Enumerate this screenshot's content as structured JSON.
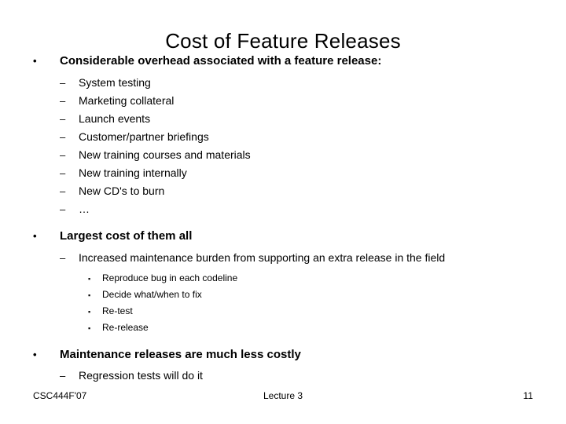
{
  "slide": {
    "title": "Cost of Feature Releases",
    "bullets": [
      {
        "level": 1,
        "marker": "•",
        "text": "Considerable overhead associated with a feature release:"
      },
      {
        "level": 2,
        "marker": "–",
        "text": "System testing"
      },
      {
        "level": 2,
        "marker": "–",
        "text": "Marketing collateral"
      },
      {
        "level": 2,
        "marker": "–",
        "text": "Launch events"
      },
      {
        "level": 2,
        "marker": "–",
        "text": "Customer/partner briefings"
      },
      {
        "level": 2,
        "marker": "–",
        "text": "New training courses and materials"
      },
      {
        "level": 2,
        "marker": "–",
        "text": "New training internally"
      },
      {
        "level": 2,
        "marker": "–",
        "text": "New CD's to burn"
      },
      {
        "level": 2,
        "marker": "–",
        "text": "…"
      },
      {
        "level": 1,
        "marker": "•",
        "text": "Largest cost of them all"
      },
      {
        "level": 2,
        "marker": "–",
        "text": "Increased maintenance burden from supporting an extra release in the field"
      },
      {
        "level": 3,
        "marker": "▪",
        "text": "Reproduce bug in each codeline"
      },
      {
        "level": 3,
        "marker": "▪",
        "text": "Decide what/when to fix"
      },
      {
        "level": 3,
        "marker": "▪",
        "text": "Re-test"
      },
      {
        "level": 3,
        "marker": "▪",
        "text": "Re-release"
      },
      {
        "level": 1,
        "marker": "•",
        "text": "Maintenance releases are much less costly"
      },
      {
        "level": 2,
        "marker": "–",
        "text": "Regression tests will do it"
      }
    ]
  },
  "footer": {
    "course": "CSC444F'07",
    "lecture": "Lecture 3",
    "page_number": "11"
  },
  "colors": {
    "background": "#ffffff",
    "text": "#000000"
  }
}
